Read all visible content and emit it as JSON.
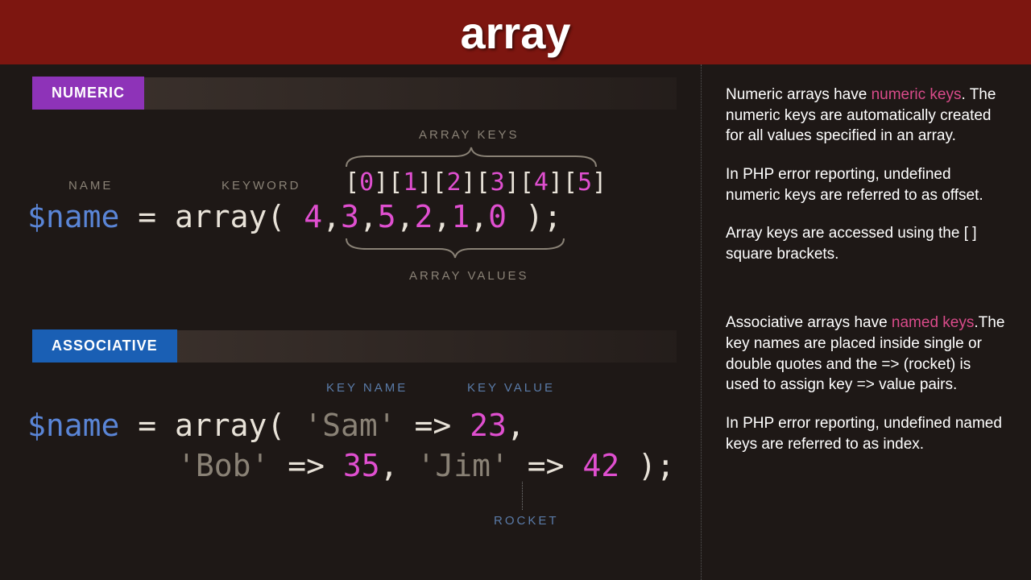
{
  "header": {
    "title": "array"
  },
  "sections": {
    "numeric": {
      "tab": "NUMERIC",
      "labels": {
        "arrayKeys": "ARRAY KEYS",
        "name": "NAME",
        "keyword": "KEYWORD",
        "arrayValues": "ARRAY VALUES"
      },
      "code": {
        "var": "$name",
        "eq": " = ",
        "kw": "array",
        "open": "( ",
        "k0": "0",
        "k1": "1",
        "k2": "2",
        "k3": "3",
        "k4": "4",
        "k5": "5",
        "v0": "4",
        "v1": "3",
        "v2": "5",
        "v3": "2",
        "v4": "1",
        "v5": "0",
        "close": " );"
      }
    },
    "assoc": {
      "tab": "ASSOCIATIVE",
      "labels": {
        "keyName": "KEY NAME",
        "keyValue": "KEY VALUE",
        "rocket": "ROCKET"
      },
      "code": {
        "var": "$name",
        "eq": " = ",
        "kw": "array",
        "open": "( ",
        "s1": "'Sam'",
        "a1": " => ",
        "n1": "23",
        "c1": ",",
        "s2": "'Bob'",
        "a2": " => ",
        "n2": "35",
        "c2": ", ",
        "s3": "'Jim'",
        "a3": " => ",
        "n3": "42",
        "close": " );"
      }
    }
  },
  "explain": {
    "p1a": "Numeric arrays have ",
    "p1b": "numeric keys",
    "p1c": ". The numeric keys are automatically created for all values specified in an array.",
    "p2": "In PHP error reporting, undefined numeric keys are referred to as offset.",
    "p3": "Array keys are accessed using the [  ] square brackets.",
    "p4a": "Associative arrays have ",
    "p4b": "named keys",
    "p4c": ".The key names are placed inside single or double quotes and the => (rocket) is used to assign key => value pairs.",
    "p5": "In PHP error reporting, undefined named keys are referred to as index."
  }
}
